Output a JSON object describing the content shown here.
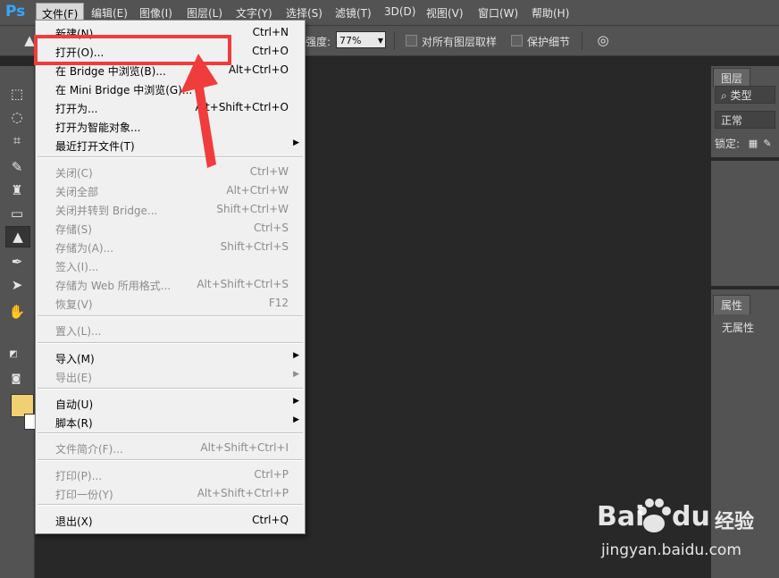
{
  "app": {
    "logo": "Ps"
  },
  "menubar": [
    "文件(F)",
    "编辑(E)",
    "图像(I)",
    "图层(L)",
    "文字(Y)",
    "选择(S)",
    "滤镜(T)",
    "3D(D)",
    "视图(V)",
    "窗口(W)",
    "帮助(H)"
  ],
  "options": {
    "strength_label": "强度:",
    "strength_value": "77%",
    "sample_all_label": "对所有图层取样",
    "protect_detail_label": "保护细节"
  },
  "file_menu": {
    "items": [
      {
        "label": "新建(N)...",
        "shortcut": "Ctrl+N",
        "disabled": false,
        "submenu": false
      },
      {
        "label": "打开(O)...",
        "shortcut": "Ctrl+O",
        "disabled": false,
        "submenu": false
      },
      {
        "label": "在 Bridge 中浏览(B)...",
        "shortcut": "Alt+Ctrl+O",
        "disabled": false,
        "submenu": false
      },
      {
        "label": "在 Mini Bridge 中浏览(G)...",
        "shortcut": "",
        "disabled": false,
        "submenu": false
      },
      {
        "label": "打开为...",
        "shortcut": "Alt+Shift+Ctrl+O",
        "disabled": false,
        "submenu": false
      },
      {
        "label": "打开为智能对象...",
        "shortcut": "",
        "disabled": false,
        "submenu": false
      },
      {
        "label": "最近打开文件(T)",
        "shortcut": "",
        "disabled": false,
        "submenu": true
      },
      {
        "label": "关闭(C)",
        "shortcut": "Ctrl+W",
        "disabled": true,
        "submenu": false
      },
      {
        "label": "关闭全部",
        "shortcut": "Alt+Ctrl+W",
        "disabled": true,
        "submenu": false
      },
      {
        "label": "关闭并转到 Bridge...",
        "shortcut": "Shift+Ctrl+W",
        "disabled": true,
        "submenu": false
      },
      {
        "label": "存储(S)",
        "shortcut": "Ctrl+S",
        "disabled": true,
        "submenu": false
      },
      {
        "label": "存储为(A)...",
        "shortcut": "Shift+Ctrl+S",
        "disabled": true,
        "submenu": false
      },
      {
        "label": "签入(I)...",
        "shortcut": "",
        "disabled": true,
        "submenu": false
      },
      {
        "label": "存储为 Web 所用格式...",
        "shortcut": "Alt+Shift+Ctrl+S",
        "disabled": true,
        "submenu": false
      },
      {
        "label": "恢复(V)",
        "shortcut": "F12",
        "disabled": true,
        "submenu": false
      },
      {
        "label": "置入(L)...",
        "shortcut": "",
        "disabled": true,
        "submenu": false
      },
      {
        "label": "导入(M)",
        "shortcut": "",
        "disabled": false,
        "submenu": true
      },
      {
        "label": "导出(E)",
        "shortcut": "",
        "disabled": true,
        "submenu": true
      },
      {
        "label": "自动(U)",
        "shortcut": "",
        "disabled": false,
        "submenu": true
      },
      {
        "label": "脚本(R)",
        "shortcut": "",
        "disabled": false,
        "submenu": true
      },
      {
        "label": "文件简介(F)...",
        "shortcut": "Alt+Shift+Ctrl+I",
        "disabled": true,
        "submenu": false
      },
      {
        "label": "打印(P)...",
        "shortcut": "Ctrl+P",
        "disabled": true,
        "submenu": false
      },
      {
        "label": "打印一份(Y)",
        "shortcut": "Alt+Shift+Ctrl+P",
        "disabled": true,
        "submenu": false
      },
      {
        "label": "退出(X)",
        "shortcut": "Ctrl+Q",
        "disabled": false,
        "submenu": false
      }
    ]
  },
  "panels": {
    "layers_tab": "图层",
    "kind_filter": "类型",
    "blend_mode": "正常",
    "lock_label": "锁定:",
    "properties_tab": "属性",
    "no_properties": "无属性"
  },
  "colors": {
    "foreground": "#f0d070",
    "background": "#ffffff",
    "highlight": "#f03c3c"
  },
  "watermark": {
    "brand_left": "Bai",
    "brand_right": "du",
    "product": "经验",
    "url": "jingyan.baidu.com"
  }
}
